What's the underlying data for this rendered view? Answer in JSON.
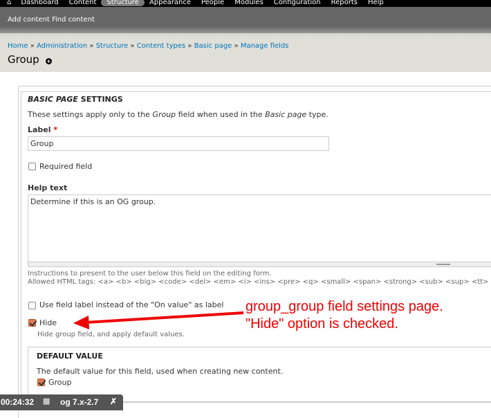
{
  "toolbar": {
    "items": [
      "Dashboard",
      "Content",
      "Structure",
      "Appearance",
      "People",
      "Modules",
      "Configuration",
      "Reports",
      "Help"
    ]
  },
  "shortcuts": [
    "Add content",
    "Find content"
  ],
  "breadcrumb": [
    "Home",
    "Administration",
    "Structure",
    "Content types",
    "Basic page",
    "Manage fields"
  ],
  "page_title": "Group",
  "settings": {
    "legend_em": "BASIC PAGE",
    "legend_rest": " SETTINGS",
    "intro": [
      "These settings apply only to the ",
      "Group",
      " field when used in the ",
      "Basic page",
      " type."
    ],
    "label_label": "Label",
    "required_mark": "*",
    "label_value": "Group",
    "required_field": "Required field",
    "help_label": "Help text",
    "help_value": "Determine if this is an OG group.",
    "help_desc1": "Instructions to present to the user below this field on the editing form.",
    "help_desc2": "Allowed HTML tags: <a> <b> <big> <code> <del> <em> <i> <ins> <pre> <q> <small> <span> <strong> <sub> <sup> <tt> <ol>",
    "use_label": "Use field label instead of the \"On value\" as label",
    "hide_label": "Hide",
    "hide_desc": "Hide group field, and apply default values."
  },
  "default_value": {
    "legend": "DEFAULT VALUE",
    "desc": "The default value for this field, used when creating new content.",
    "group_label": "Group"
  },
  "annotation": [
    "group_group field settings page.",
    "\"Hide\" option is checked."
  ],
  "overlay": {
    "time": "00:24:32",
    "version": "og 7.x-2.7",
    "close": "✗"
  },
  "colors": {
    "annotation": "#ee0000",
    "link": "#0074bd"
  }
}
